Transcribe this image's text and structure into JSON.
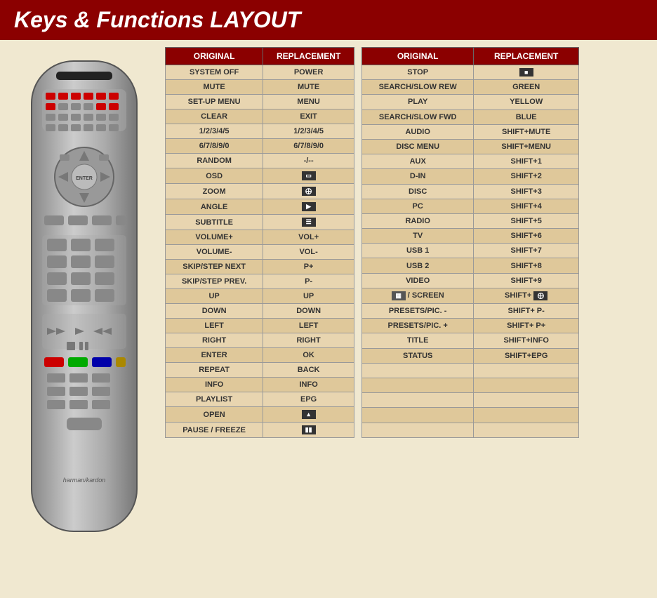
{
  "header": {
    "title": "Keys & Functions LAYOUT"
  },
  "left_table": {
    "columns": [
      "ORIGINAL",
      "REPLACEMENT"
    ],
    "rows": [
      [
        "SYSTEM OFF",
        "POWER"
      ],
      [
        "MUTE",
        "MUTE"
      ],
      [
        "SET-UP MENU",
        "MENU"
      ],
      [
        "CLEAR",
        "EXIT"
      ],
      [
        "1/2/3/4/5",
        "1/2/3/4/5"
      ],
      [
        "6/7/8/9/0",
        "6/7/8/9/0"
      ],
      [
        "RANDOM",
        "-/--"
      ],
      [
        "OSD",
        "osd_icon"
      ],
      [
        "ZOOM",
        "zoom_icon"
      ],
      [
        "ANGLE",
        "angle_icon"
      ],
      [
        "SUBTITLE",
        "subtitle_icon"
      ],
      [
        "VOLUME+",
        "VOL+"
      ],
      [
        "VOLUME-",
        "VOL-"
      ],
      [
        "SKIP/STEP NEXT",
        "P+"
      ],
      [
        "SKIP/STEP PREV.",
        "P-"
      ],
      [
        "UP",
        "UP"
      ],
      [
        "DOWN",
        "DOWN"
      ],
      [
        "LEFT",
        "LEFT"
      ],
      [
        "RIGHT",
        "RIGHT"
      ],
      [
        "ENTER",
        "OK"
      ],
      [
        "REPEAT",
        "BACK"
      ],
      [
        "INFO",
        "INFO"
      ],
      [
        "PLAYLIST",
        "EPG"
      ],
      [
        "OPEN",
        "open_icon"
      ],
      [
        "PAUSE / FREEZE",
        "pause_icon"
      ]
    ]
  },
  "right_table": {
    "columns": [
      "ORIGINAL",
      "REPLACEMENT"
    ],
    "rows": [
      [
        "STOP",
        "stop_icon"
      ],
      [
        "SEARCH/SLOW REW",
        "GREEN"
      ],
      [
        "PLAY",
        "YELLOW"
      ],
      [
        "SEARCH/SLOW FWD",
        "BLUE"
      ],
      [
        "AUDIO",
        "SHIFT+MUTE"
      ],
      [
        "DISC MENU",
        "SHIFT+MENU"
      ],
      [
        "AUX",
        "SHIFT+1"
      ],
      [
        "D-IN",
        "SHIFT+2"
      ],
      [
        "DISC",
        "SHIFT+3"
      ],
      [
        "PC",
        "SHIFT+4"
      ],
      [
        "RADIO",
        "SHIFT+5"
      ],
      [
        "TV",
        "SHIFT+6"
      ],
      [
        "USB 1",
        "SHIFT+7"
      ],
      [
        "USB 2",
        "SHIFT+8"
      ],
      [
        "VIDEO",
        "SHIFT+9"
      ],
      [
        "screen_icon / SCREEN",
        "shift_screen_icon"
      ],
      [
        "PRESETS/PIC. -",
        "SHIFT+ P-"
      ],
      [
        "PRESETS/PIC. +",
        "SHIFT+ P+"
      ],
      [
        "TITLE",
        "SHIFT+INFO"
      ],
      [
        "STATUS",
        "SHIFT+EPG"
      ]
    ]
  }
}
